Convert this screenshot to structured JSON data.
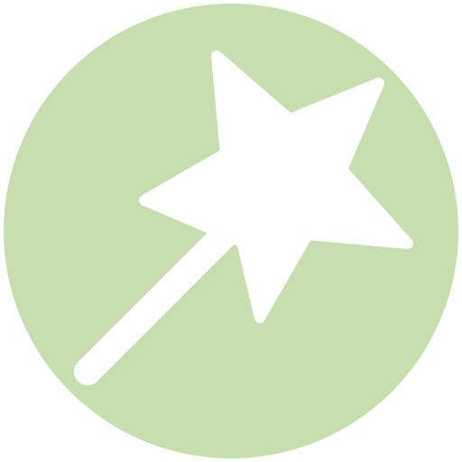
{
  "icon": {
    "name": "magic-wand-icon",
    "colors": {
      "circle_background": "#C7DFAF",
      "glyph": "#FFFFFF",
      "page_background": "#FFFFFF"
    }
  }
}
